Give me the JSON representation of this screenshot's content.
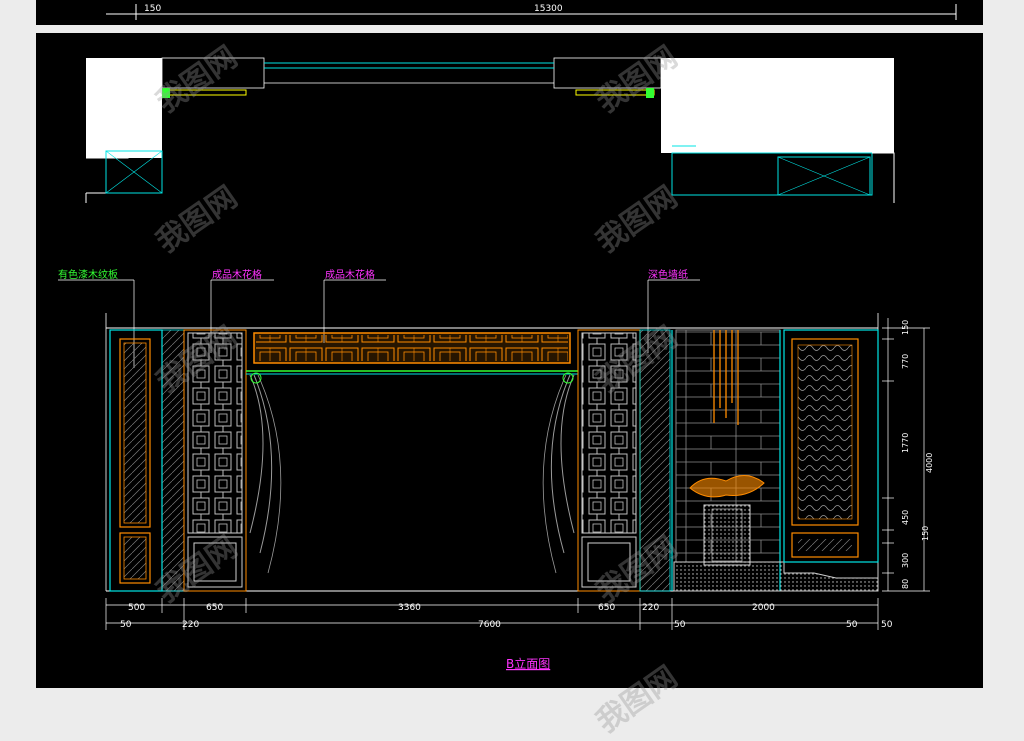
{
  "top_strip": {
    "dims": [
      "150",
      "15300"
    ]
  },
  "callouts": [
    {
      "text": "有色漆木纹板",
      "color": "#33ff33"
    },
    {
      "text": "成品木花格",
      "color": "#ff33ff"
    },
    {
      "text": "成品木花格",
      "color": "#ff33ff"
    },
    {
      "text": "深色墙纸",
      "color": "#ff33ff"
    }
  ],
  "dims_bottom_row1": [
    "500",
    "650",
    "3360",
    "650",
    "220",
    "2000"
  ],
  "dims_bottom_row2": [
    "50",
    "220",
    "7600",
    "50",
    "50",
    "50"
  ],
  "dims_right": [
    "150",
    "770",
    "1770",
    "450",
    "150",
    "300",
    "4000",
    "80"
  ],
  "drawing_title": "B立面图",
  "watermark": "我图网",
  "colors": {
    "cyan": "#00e5e5",
    "orange": "#ff8c00",
    "white": "#ffffff",
    "green": "#33ff33",
    "magenta": "#ff33ff",
    "yellow": "#ffff00",
    "grey": "#9a9a9a"
  }
}
